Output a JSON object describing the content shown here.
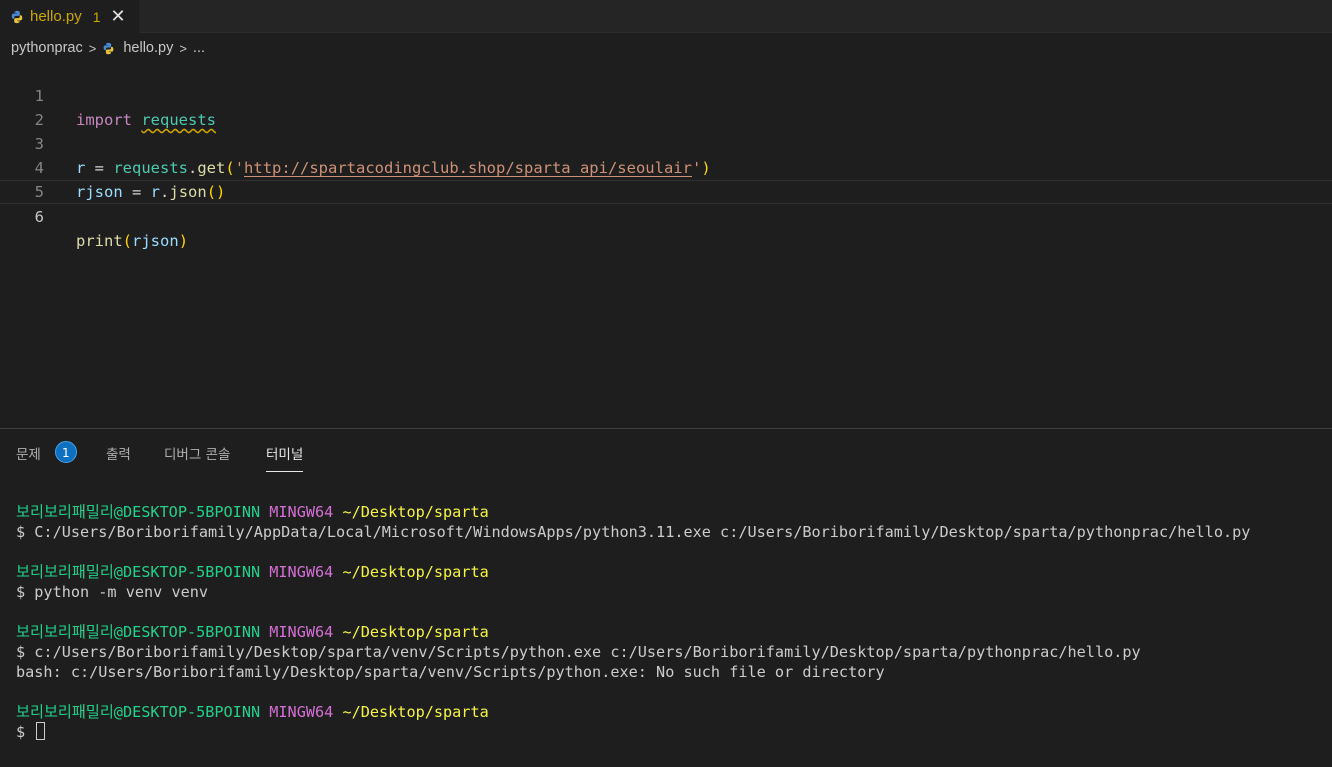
{
  "tab": {
    "filename": "hello.py",
    "problem_count": "1",
    "close_glyph": "✕"
  },
  "breadcrumb": {
    "folder": "pythonprac",
    "file": "hello.py",
    "more": "..."
  },
  "editor": {
    "lines": [
      {
        "num": "1",
        "tokens": [
          "import",
          " ",
          "requests"
        ]
      },
      {
        "num": "2"
      },
      {
        "num": "3",
        "tokens": [
          "r",
          " = ",
          "requests",
          ".",
          "get",
          "(",
          "'",
          "http://spartacodingclub.shop/sparta_api/seoulair",
          "'",
          ")"
        ]
      },
      {
        "num": "4",
        "tokens": [
          "rjson",
          " = ",
          "r",
          ".",
          "json",
          "()"
        ]
      },
      {
        "num": "5"
      },
      {
        "num": "6",
        "tokens": [
          "print",
          "(",
          "rjson",
          ")"
        ]
      }
    ]
  },
  "panel": {
    "tabs": [
      {
        "label": "문제",
        "badge": "1"
      },
      {
        "label": "출력"
      },
      {
        "label": "디버그 콘솔"
      },
      {
        "label": "터미널",
        "active": true
      }
    ]
  },
  "terminal": {
    "prompt": {
      "user": "보리보리패밀리@DESKTOP-5BPOINN",
      "system": "MINGW64",
      "path": "~/Desktop/sparta"
    },
    "commands": [
      "$ C:/Users/Boriborifamily/AppData/Local/Microsoft/WindowsApps/python3.11.exe c:/Users/Boriborifamily/Desktop/sparta/pythonprac/hello.py",
      "$ python -m venv venv",
      "$ c:/Users/Boriborifamily/Desktop/sparta/venv/Scripts/python.exe c:/Users/Boriborifamily/Desktop/sparta/pythonprac/hello.py",
      "$ "
    ],
    "error": "bash: c:/Users/Boriborifamily/Desktop/sparta/venv/Scripts/python.exe: No such file or directory"
  },
  "colors": {
    "accent": "#0e70c0",
    "warning": "#cca700",
    "terminal_user": "#23d18b",
    "terminal_system": "#d670d6",
    "terminal_path": "#f5f543"
  },
  "icons": {
    "file": "python-file-icon"
  }
}
